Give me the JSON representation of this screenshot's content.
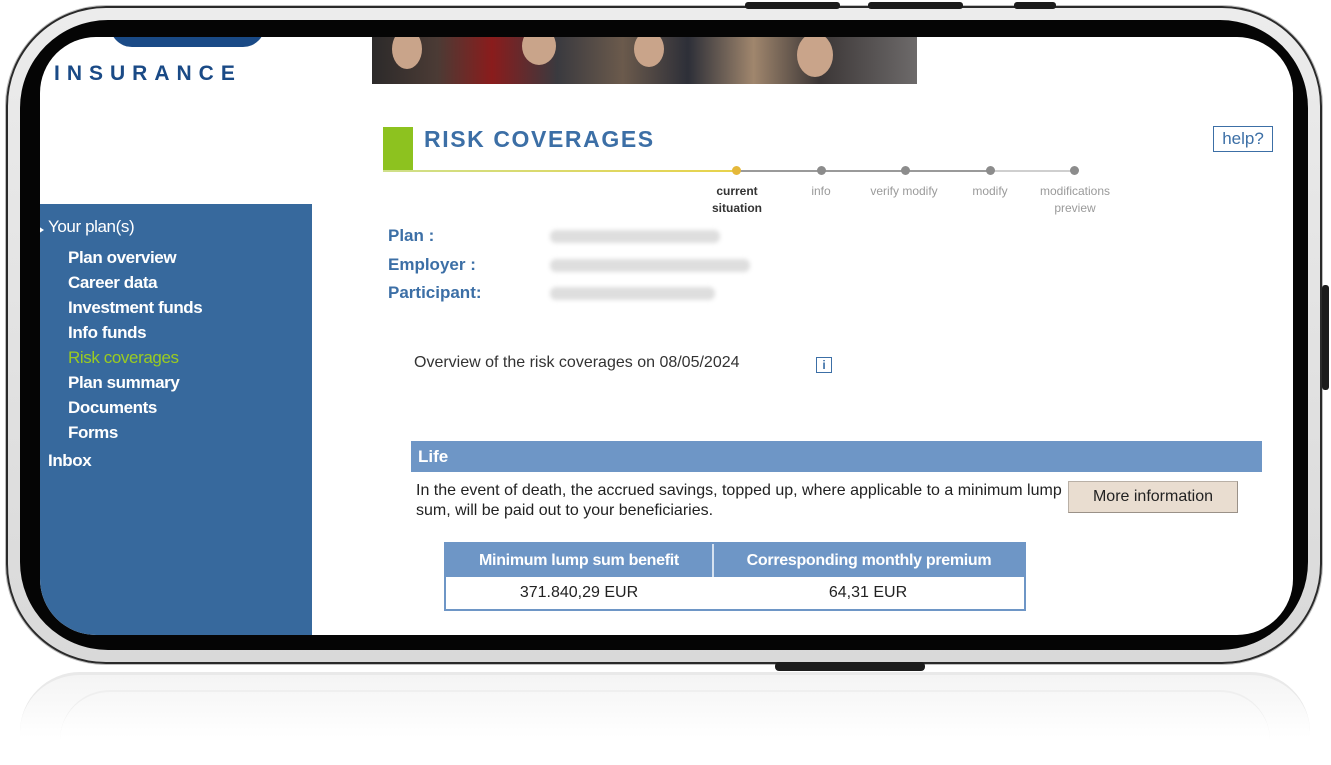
{
  "brand": {
    "logo_text": "INSURANCE"
  },
  "page": {
    "title": "RISK COVERAGES",
    "help_label": "help?"
  },
  "progress_steps": [
    {
      "label": "current situation",
      "state": "current"
    },
    {
      "label": "info",
      "state": "pending"
    },
    {
      "label": "verify modify",
      "state": "pending"
    },
    {
      "label": "modify",
      "state": "pending"
    },
    {
      "label": "modifications preview",
      "state": "pending"
    }
  ],
  "sidebar": {
    "items": [
      {
        "label": "Your plan(s)",
        "level": 0,
        "active": false
      },
      {
        "label": "Plan overview",
        "level": 1,
        "active": false
      },
      {
        "label": "Career data",
        "level": 1,
        "active": false
      },
      {
        "label": "Investment funds",
        "level": 1,
        "active": false
      },
      {
        "label": "Info funds",
        "level": 1,
        "active": false
      },
      {
        "label": "Risk coverages",
        "level": 1,
        "active": true
      },
      {
        "label": "Plan summary",
        "level": 1,
        "active": false
      },
      {
        "label": "Documents",
        "level": 1,
        "active": false
      },
      {
        "label": "Forms",
        "level": 1,
        "active": false
      },
      {
        "label": "Inbox",
        "level": 0,
        "active": false
      }
    ]
  },
  "plan_info": {
    "plan_label": "Plan :",
    "employer_label": "Employer :",
    "participant_label": "Participant:"
  },
  "overview_text": "Overview of the risk coverages on 08/05/2024",
  "info_icon": "i",
  "life": {
    "heading": "Life",
    "description": "In the event of death, the accrued savings, topped up, where applicable to a minimum lump sum, will be paid out to your beneficiaries.",
    "more_button": "More information",
    "table": {
      "headers": [
        "Minimum lump sum benefit",
        "Corresponding monthly premium"
      ],
      "row": [
        "371.840,29 EUR",
        "64,31 EUR"
      ]
    }
  },
  "colors": {
    "sidebar_bg": "#37699d",
    "accent_green": "#8dc21f",
    "title_blue": "#3c6fa6",
    "section_bar": "#6e96c6",
    "current_step": "#e5b83a"
  }
}
